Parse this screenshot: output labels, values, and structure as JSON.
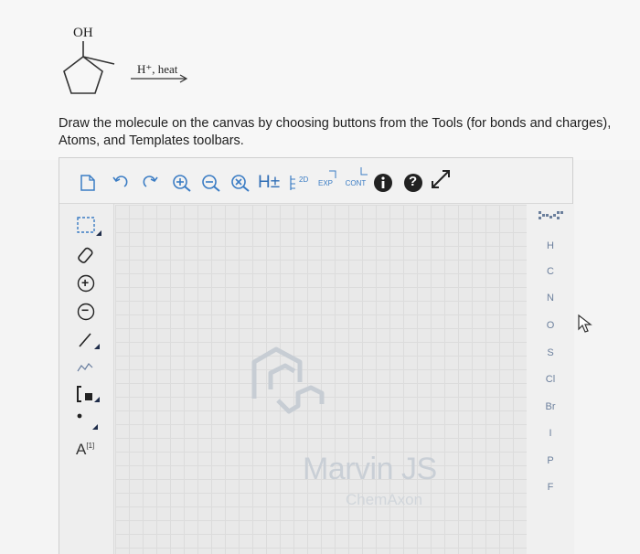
{
  "question": {
    "oh_label": "OH",
    "conditions": "H⁺, heat",
    "prompt": "Draw the molecule on the canvas by choosing buttons from the Tools (for bonds and charges), Atoms, and Templates toolbars."
  },
  "editor": {
    "toolbar": {
      "h_toggle": "H±",
      "view_2d": "2D",
      "expand": "EXP",
      "contract": "CONT",
      "help": "?"
    },
    "left_tools": {
      "charge_plus": "+",
      "charge_minus": "−",
      "atom_list": "A",
      "atom_list_sup": "[1]"
    },
    "watermark": {
      "brand": "Marvin JS",
      "maker": "ChemAxon"
    },
    "atoms": [
      "H",
      "C",
      "N",
      "O",
      "S",
      "Cl",
      "Br",
      "I",
      "P",
      "F"
    ]
  },
  "colors": {
    "accent": "#3a7cc4",
    "dark_icon": "#222222",
    "atom_text": "#6b7f9c",
    "watermark": "#c9cfd6"
  }
}
